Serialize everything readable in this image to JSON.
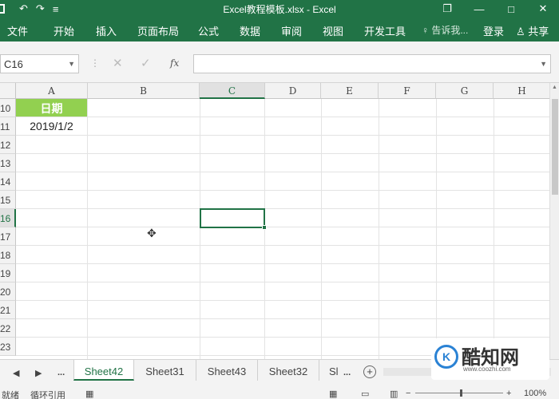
{
  "window": {
    "title": "Excel教程模板.xlsx - Excel",
    "undo": "↶",
    "redo": "↷",
    "customize": "≡",
    "restore": "❐",
    "minimize": "—",
    "maximize": "□",
    "close": "✕"
  },
  "ribbon": {
    "tabs": [
      "文件",
      "开始",
      "插入",
      "页面布局",
      "公式",
      "数据",
      "审阅",
      "视图",
      "开发工具"
    ],
    "tell_me": "告诉我...",
    "login": "登录",
    "share": "共享"
  },
  "formula_bar": {
    "name_box": "C16",
    "cancel": "✕",
    "confirm": "✓",
    "fx": "fx",
    "formula": ""
  },
  "grid": {
    "columns": [
      "A",
      "B",
      "C",
      "D",
      "E",
      "F",
      "G",
      "H"
    ],
    "selected_column": "C",
    "rows": [
      "10",
      "11",
      "12",
      "13",
      "14",
      "15",
      "16",
      "17",
      "18",
      "19",
      "20",
      "21",
      "22",
      "23"
    ],
    "selected_row": "16",
    "cells": {
      "A10": "日期",
      "A11": "2019/1/2"
    },
    "header_fill": "#92d050",
    "selection_color": "#217346"
  },
  "sheets": {
    "tabs": [
      "Sheet42",
      "Sheet31",
      "Sheet43",
      "Sheet32",
      "Sl"
    ],
    "active": "Sheet42",
    "more": "...",
    "trailing_more": "..."
  },
  "status": {
    "ready": "就绪",
    "circular": "循环引用",
    "zoom": "100%"
  },
  "watermark": {
    "brand": "酷知网",
    "url": "www.coozhi.com"
  }
}
